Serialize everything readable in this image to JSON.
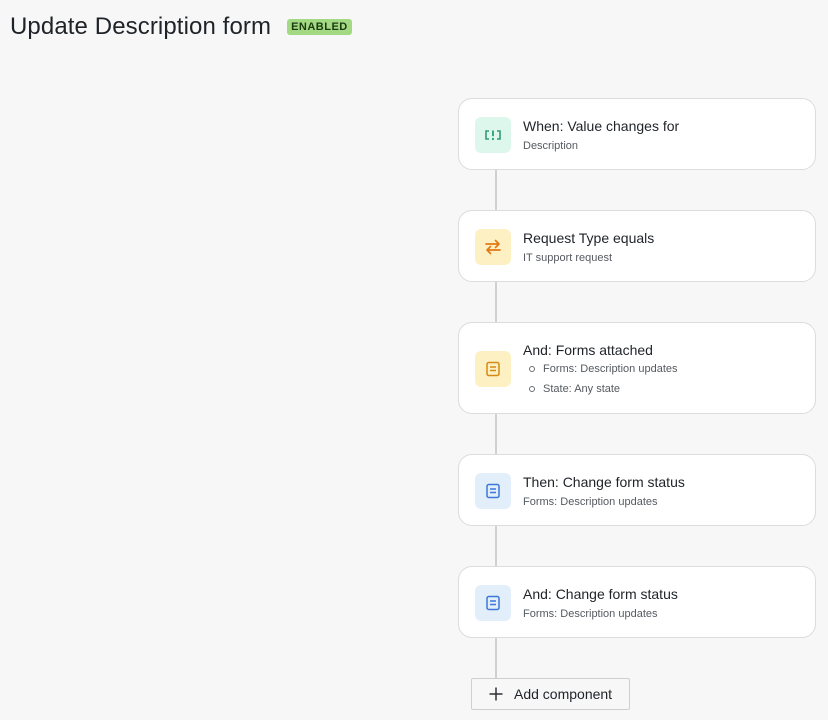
{
  "header": {
    "title": "Update Description form",
    "status": "ENABLED"
  },
  "colors": {
    "badge_bg": "#a3d982",
    "trigger_icon": "#2f9d72",
    "condition_icon": "#e27a14",
    "form_icon_yellow": "#d58a14",
    "form_icon_blue": "#3b78d8"
  },
  "rules": [
    {
      "icon": "value-change-icon",
      "title": "When: Value changes for",
      "subtitle": "Description"
    },
    {
      "icon": "swap-arrows-icon",
      "title": "Request Type equals",
      "subtitle": "IT support request"
    },
    {
      "icon": "form-icon",
      "title": "And: Forms attached",
      "items": [
        "Forms: Description updates",
        "State: Any state"
      ]
    },
    {
      "icon": "form-icon",
      "title": "Then: Change form status",
      "subtitle": "Forms: Description updates"
    },
    {
      "icon": "form-icon",
      "title": "And: Change form status",
      "subtitle": "Forms: Description updates"
    }
  ],
  "add_button": {
    "icon": "plus-icon",
    "label": "Add component"
  }
}
